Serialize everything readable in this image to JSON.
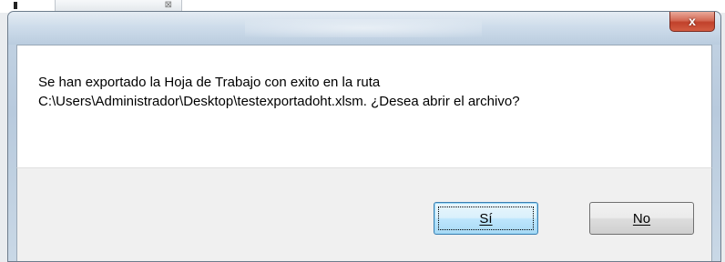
{
  "background": {
    "widget_glyph": "⊠"
  },
  "dialog": {
    "close_icon": "x",
    "message_lines": [
      "Se han exportado la Hoja de Trabajo con exito en la ruta",
      "C:\\Users\\Administrador\\Desktop\\testexportadoht.xlsm. ¿Desea abrir el archivo?"
    ],
    "buttons": {
      "yes_label": "Sí",
      "no_label": "No"
    }
  },
  "colors": {
    "close_button": "#c0412b",
    "default_button_border": "#3c7fb1",
    "button_area": "#f0f0f0"
  }
}
